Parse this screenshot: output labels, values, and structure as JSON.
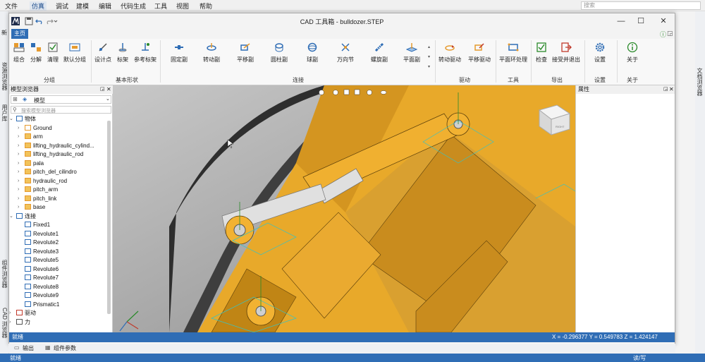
{
  "outer_menu": [
    "文件",
    "仿真",
    "调试",
    "建模",
    "编辑",
    "代码生成",
    "工具",
    "视图",
    "帮助"
  ],
  "outer_active": "仿真",
  "outer_search_placeholder": "搜索",
  "outer_left_labels": [
    "资源浏览器",
    "用户库",
    "组件浏览器",
    "CAD 浏览器"
  ],
  "outer_left_extra": "新",
  "outer_right_labels": [
    "文档浏览器"
  ],
  "outer_status_left": "就绪",
  "outer_status_right": "读/写",
  "bottom_tabs": [
    "输出",
    "组件参数"
  ],
  "window": {
    "title": "CAD 工具箱 - bulldozer.STEP",
    "tab": "主页"
  },
  "ribbon": {
    "groups": [
      {
        "label": "分组",
        "items": [
          "组合",
          "分解",
          "清理",
          "默认分组"
        ]
      },
      {
        "label": "基本形状",
        "items": [
          "设计点",
          "标架",
          "参考标架"
        ]
      },
      {
        "label": "连接",
        "items": [
          "固定副",
          "转动副",
          "平移副",
          "圆柱副",
          "球副",
          "万向节",
          "螺旋副",
          "平面副"
        ]
      },
      {
        "label": "驱动",
        "items": [
          "转动驱动",
          "平移驱动"
        ]
      },
      {
        "label": "工具",
        "items": [
          "平面环处理"
        ]
      },
      {
        "label": "导出",
        "items": [
          "检查",
          "接受并退出"
        ]
      },
      {
        "label": "设置",
        "items": [
          "设置"
        ]
      },
      {
        "label": "关于",
        "items": [
          "关于"
        ]
      }
    ]
  },
  "model_browser": {
    "title": "模型浏览器",
    "selector": "模型",
    "search_placeholder": "搜索模型浏览器",
    "tree": [
      {
        "label": "物体",
        "level": 0,
        "expanded": true,
        "icon": "body-icon"
      },
      {
        "label": "Ground",
        "level": 1,
        "icon": "ground-icon"
      },
      {
        "label": "arm",
        "level": 1,
        "icon": "folder-icon"
      },
      {
        "label": "lifting_hydraulic_cylind...",
        "level": 1,
        "icon": "folder-icon"
      },
      {
        "label": "lifting_hydraulic_rod",
        "level": 1,
        "icon": "folder-icon"
      },
      {
        "label": "pala",
        "level": 1,
        "icon": "folder-icon"
      },
      {
        "label": "pitch_del_cilindro",
        "level": 1,
        "icon": "folder-icon"
      },
      {
        "label": "hydraulic_rod",
        "level": 1,
        "icon": "folder-icon"
      },
      {
        "label": "pitch_arm",
        "level": 1,
        "icon": "folder-icon"
      },
      {
        "label": "pitch_link",
        "level": 1,
        "icon": "folder-icon"
      },
      {
        "label": "base",
        "level": 1,
        "icon": "folder-icon"
      },
      {
        "label": "连接",
        "level": 0,
        "expanded": true,
        "icon": "joint-icon"
      },
      {
        "label": "Fixed1",
        "level": 1,
        "icon": "fixed-icon"
      },
      {
        "label": "Revolute1",
        "level": 1,
        "icon": "revolute-icon"
      },
      {
        "label": "Revolute2",
        "level": 1,
        "icon": "revolute-icon"
      },
      {
        "label": "Revolute3",
        "level": 1,
        "icon": "revolute-icon"
      },
      {
        "label": "Revolute5",
        "level": 1,
        "icon": "revolute-icon"
      },
      {
        "label": "Revolute6",
        "level": 1,
        "icon": "revolute-icon"
      },
      {
        "label": "Revolute7",
        "level": 1,
        "icon": "revolute-icon"
      },
      {
        "label": "Revolute8",
        "level": 1,
        "icon": "revolute-icon"
      },
      {
        "label": "Revolute9",
        "level": 1,
        "icon": "revolute-icon"
      },
      {
        "label": "Prismatic1",
        "level": 1,
        "icon": "prismatic-icon"
      },
      {
        "label": "驱动",
        "level": 0,
        "expanded": false,
        "icon": "drive-icon"
      },
      {
        "label": "力",
        "level": 0,
        "expanded": false,
        "icon": "force-icon"
      }
    ]
  },
  "properties": {
    "title": "属性"
  },
  "status": {
    "left": "就绪",
    "coords": "X = -0.296377  Y = 0.549783  Z = 1.424147"
  },
  "viewcube_label": "RIGHT",
  "colors": {
    "accent": "#2f6db5",
    "part": "#e8a92a",
    "tire": "#3a3a3a"
  }
}
